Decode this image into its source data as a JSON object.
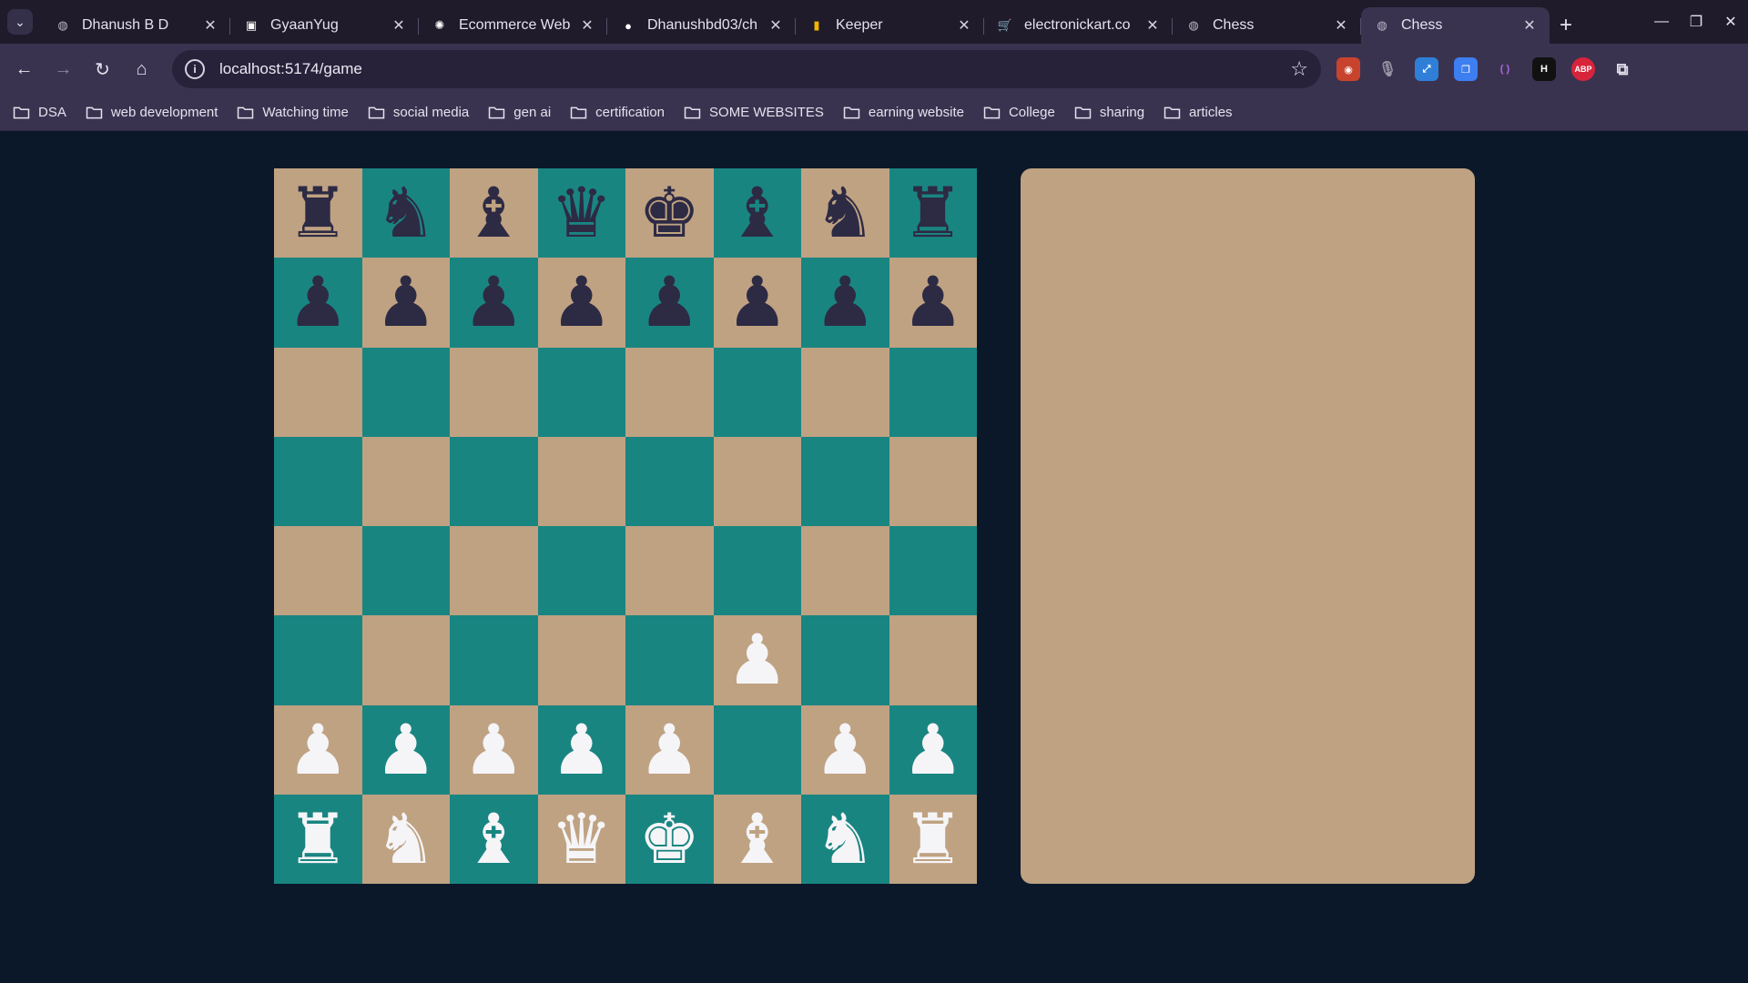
{
  "browser": {
    "tabs": [
      {
        "title": "Dhanush B D",
        "favicon": "globe-icon",
        "active": false
      },
      {
        "title": "GyaanYug",
        "favicon": "gyaanyug-icon",
        "active": false
      },
      {
        "title": "Ecommerce Web",
        "favicon": "openai-icon",
        "active": false
      },
      {
        "title": "Dhanushbd03/ch",
        "favicon": "github-icon",
        "active": false
      },
      {
        "title": "Keeper",
        "favicon": "keep-icon",
        "active": false
      },
      {
        "title": "electronickart.co",
        "favicon": "cart-icon",
        "active": false
      },
      {
        "title": "Chess",
        "favicon": "globe-icon",
        "active": false
      },
      {
        "title": "Chess",
        "favicon": "globe-icon",
        "active": true
      }
    ],
    "url": "localhost:5174/game",
    "bookmarks": [
      "DSA",
      "web development",
      "Watching time",
      "social media",
      "gen ai",
      "certification",
      "SOME WEBSITES",
      "earning website",
      "College",
      "sharing",
      "articles"
    ]
  },
  "colors": {
    "page_bg": "#0b1829",
    "light_square": "#bfa282",
    "dark_square": "#198581",
    "black_piece": "#2d2a44",
    "white_piece": "#f5f5f8"
  },
  "board": [
    [
      "r",
      "n",
      "b",
      "q",
      "k",
      "b",
      "n",
      "r"
    ],
    [
      "p",
      "p",
      "p",
      "p",
      "p",
      "p",
      "p",
      "p"
    ],
    [
      "",
      "",
      "",
      "",
      "",
      "",
      "",
      ""
    ],
    [
      "",
      "",
      "",
      "",
      "",
      "",
      "",
      ""
    ],
    [
      "",
      "",
      "",
      "",
      "",
      "",
      "",
      ""
    ],
    [
      "",
      "",
      "",
      "",
      "",
      "P",
      "",
      ""
    ],
    [
      "P",
      "P",
      "P",
      "P",
      "P",
      "",
      "P",
      "P"
    ],
    [
      "R",
      "N",
      "B",
      "Q",
      "K",
      "B",
      "N",
      "R"
    ]
  ]
}
